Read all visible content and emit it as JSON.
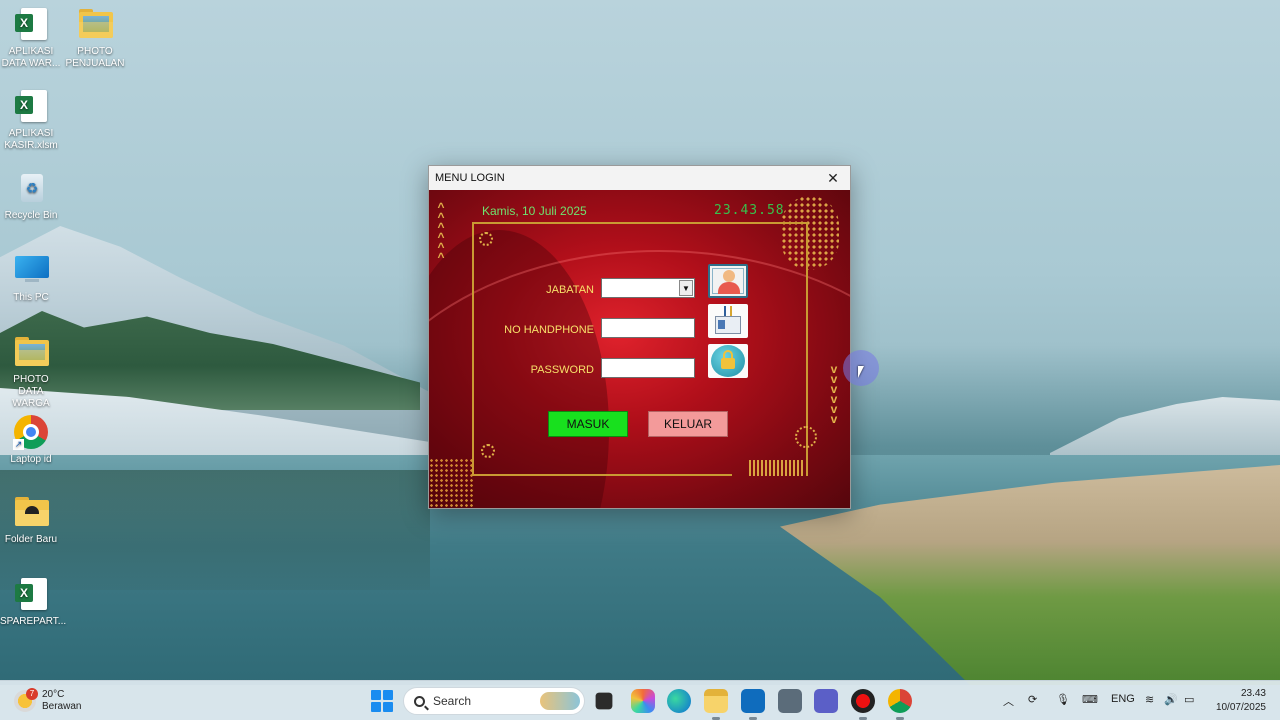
{
  "desktop": {
    "icons": [
      {
        "label": "APLIKASI DATA WAR...",
        "type": "excel"
      },
      {
        "label": "PHOTO PENJUALAN",
        "type": "folder"
      },
      {
        "label": "APLIKASI KASIR.xlsm",
        "type": "excel"
      },
      {
        "label": "Recycle Bin",
        "type": "recycle-bin"
      },
      {
        "label": "This PC",
        "type": "this-pc"
      },
      {
        "label": "PHOTO DATA WARGA",
        "type": "folder"
      },
      {
        "label": "Laptop id",
        "type": "chrome-shortcut"
      },
      {
        "label": "Folder Baru",
        "type": "folder"
      },
      {
        "label": "SPAREPART...",
        "type": "excel"
      }
    ]
  },
  "dialog": {
    "title": "MENU LOGIN",
    "close_glyph": "✕",
    "date_text": "Kamis, 10 Juli 2025",
    "clock_text": "23.43.58",
    "fields": {
      "jabatan_label": "JABATAN",
      "jabatan_value": "",
      "handphone_label": "NO HANDPHONE",
      "handphone_value": "",
      "password_label": "PASSWORD",
      "password_value": ""
    },
    "buttons": {
      "masuk": "MASUK",
      "keluar": "KELUAR"
    },
    "colors": {
      "background": "#b10f1a",
      "gold": "#c99a33",
      "label": "#f7e06a",
      "date": "#6fe36f",
      "masuk": "#18e01e",
      "keluar": "#f39a9a"
    }
  },
  "taskbar": {
    "weather_temp": "20°C",
    "weather_desc": "Berawan",
    "weather_badge": "7",
    "search_placeholder": "Search",
    "apps": [
      "file-explorer",
      "copilot",
      "edge",
      "folder",
      "outlook",
      "camera",
      "teams",
      "record",
      "chrome"
    ],
    "tray": {
      "language": "ENG",
      "time": "23.43",
      "date": "10/07/2025"
    }
  }
}
